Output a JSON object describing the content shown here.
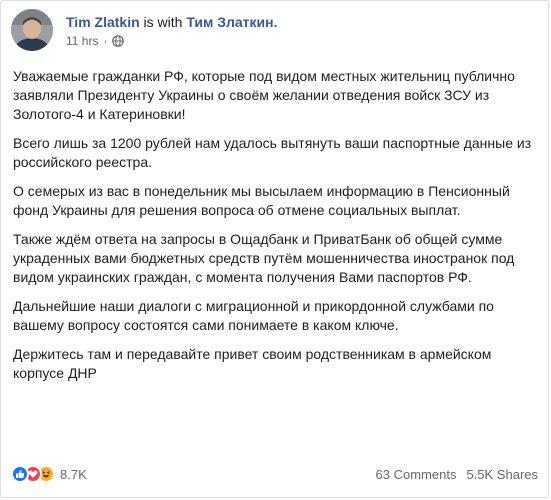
{
  "post": {
    "author": "Tim Zlatkin",
    "with_text": "is with",
    "tagged": "Тим Златкин.",
    "timestamp": "11 hrs",
    "dot": "·",
    "paragraphs": [
      "Уважаемые гражданки РФ, которые под видом местных жительниц публично заявляли Президенту Украины о своём желании отведения войск ЗСУ из Золотого-4 и Катериновки!",
      "Всего лишь за 1200 рублей нам удалось вытянуть ваши паспортные данные из российского реестра.",
      "О семерых из вас в понедельник мы высылаем информацию в Пенсионный фонд Украины для решения вопроса об отмене социальных выплат.",
      "Также ждём ответа на запросы в Ощадбанк и ПриватБанк об общей сумме украденных вами бюджетных средств путём мошенничества иностранок под видом украинских граждан, с момента получения Вами паспортов РФ.",
      "Дальнейшие наши диалоги с миграционной и прикордонной службами по вашему вопросу состоятся сами понимаете в каком ключе.",
      "Держитесь там и передавайте привет своим родственникам в армейском корпусе ДНР"
    ]
  },
  "footer": {
    "reactions_count": "8.7K",
    "comments": "63 Comments",
    "shares": "5.5K Shares"
  },
  "icons": {
    "globe": "globe-icon",
    "like": "like-reaction-icon",
    "love": "love-reaction-icon",
    "haha": "haha-reaction-icon"
  },
  "colors": {
    "author_link": "#385898",
    "like": "#1877f2",
    "love": "#f33e58",
    "haha": "#f7b125",
    "secondary_text": "#616770"
  }
}
